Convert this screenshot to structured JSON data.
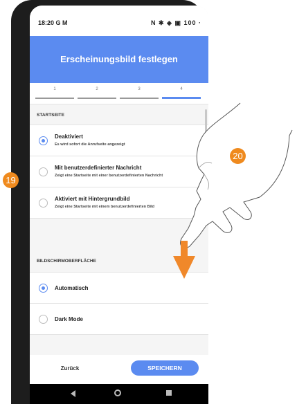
{
  "status_bar": {
    "time": "18:20",
    "left_icons": "G M",
    "right_icons": "N ✱ ◈ ▣ 100 ·"
  },
  "header": {
    "title": "Erscheinungsbild festlegen"
  },
  "stepper": {
    "steps": [
      "1",
      "2",
      "3",
      "4"
    ],
    "active_step": "4"
  },
  "startseite": {
    "heading": "STARTSEITE",
    "options": [
      {
        "title": "Deaktiviert",
        "subtitle": "Es wird sofort die Anrufseite angezeigt",
        "selected": true
      },
      {
        "title": "Mit benutzerdefinierter Nachricht",
        "subtitle": "Zeigt eine Startseite mit einer benutzerdefinierten Nachricht",
        "selected": false
      },
      {
        "title": "Aktiviert mit Hintergrundbild",
        "subtitle": "Zeigt eine Startseite mit einem benutzerdefinierten Bild",
        "selected": false
      }
    ]
  },
  "bildschirm": {
    "heading": "BILDSCHIRMOBERFLÄCHE",
    "options": [
      {
        "title": "Automatisch",
        "selected": true
      },
      {
        "title": "Dark Mode",
        "selected": false
      }
    ]
  },
  "footer": {
    "back_label": "Zurück",
    "save_label": "SPEICHERN"
  },
  "callouts": {
    "left": "19",
    "right": "20"
  },
  "colors": {
    "accent": "#5b8bf0",
    "callout": "#ef8a1e",
    "arrow": "#f0882a"
  }
}
